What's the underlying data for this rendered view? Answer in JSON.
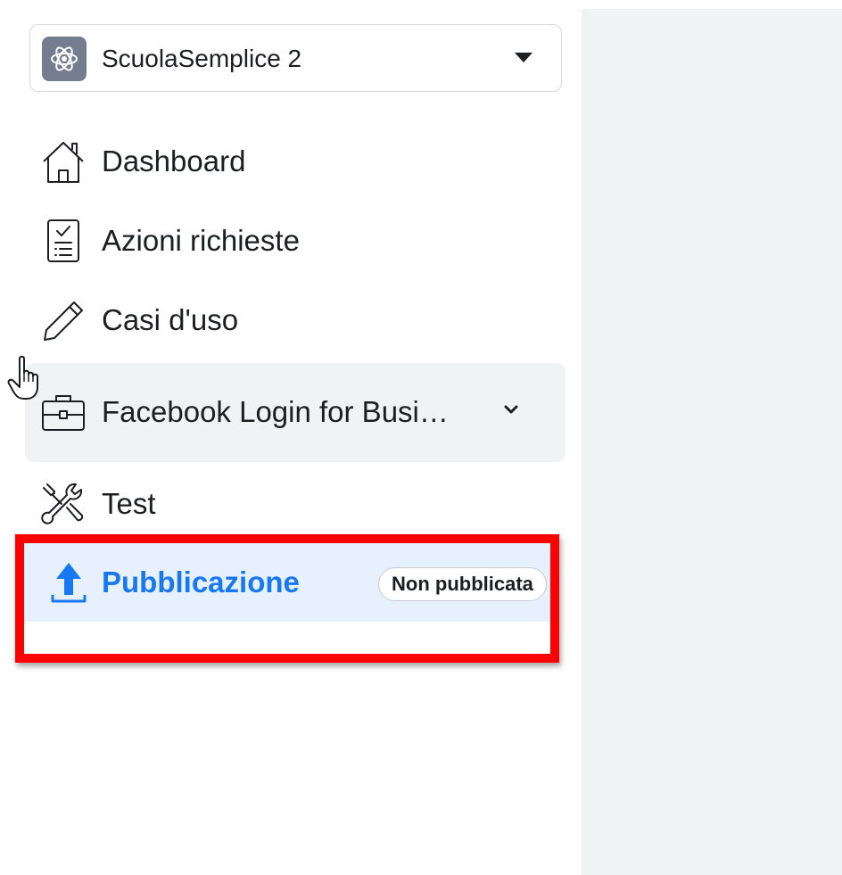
{
  "app_selector": {
    "name": "ScuolaSemplice 2",
    "logo_icon": "atom-icon",
    "caret_icon": "caret-down-icon"
  },
  "nav": {
    "items": [
      {
        "label": "Dashboard",
        "icon": "home-icon"
      },
      {
        "label": "Azioni richieste",
        "icon": "checklist-icon"
      },
      {
        "label": "Casi d'uso",
        "icon": "pencil-icon"
      },
      {
        "label": "Facebook Login for Busi…",
        "icon": "briefcase-icon",
        "expandable": true,
        "hovered": true
      },
      {
        "label": "Test",
        "icon": "tools-icon"
      }
    ],
    "publish": {
      "label": "Pubblicazione",
      "icon": "upload-icon",
      "status": "Non pubblicata",
      "selected": true
    }
  },
  "colors": {
    "accent": "#1877f2",
    "highlight_border": "#ff0000",
    "selected_bg": "#e7f0fd",
    "hover_bg": "#f1f2f4",
    "panel_bg": "#f1f2f4"
  }
}
